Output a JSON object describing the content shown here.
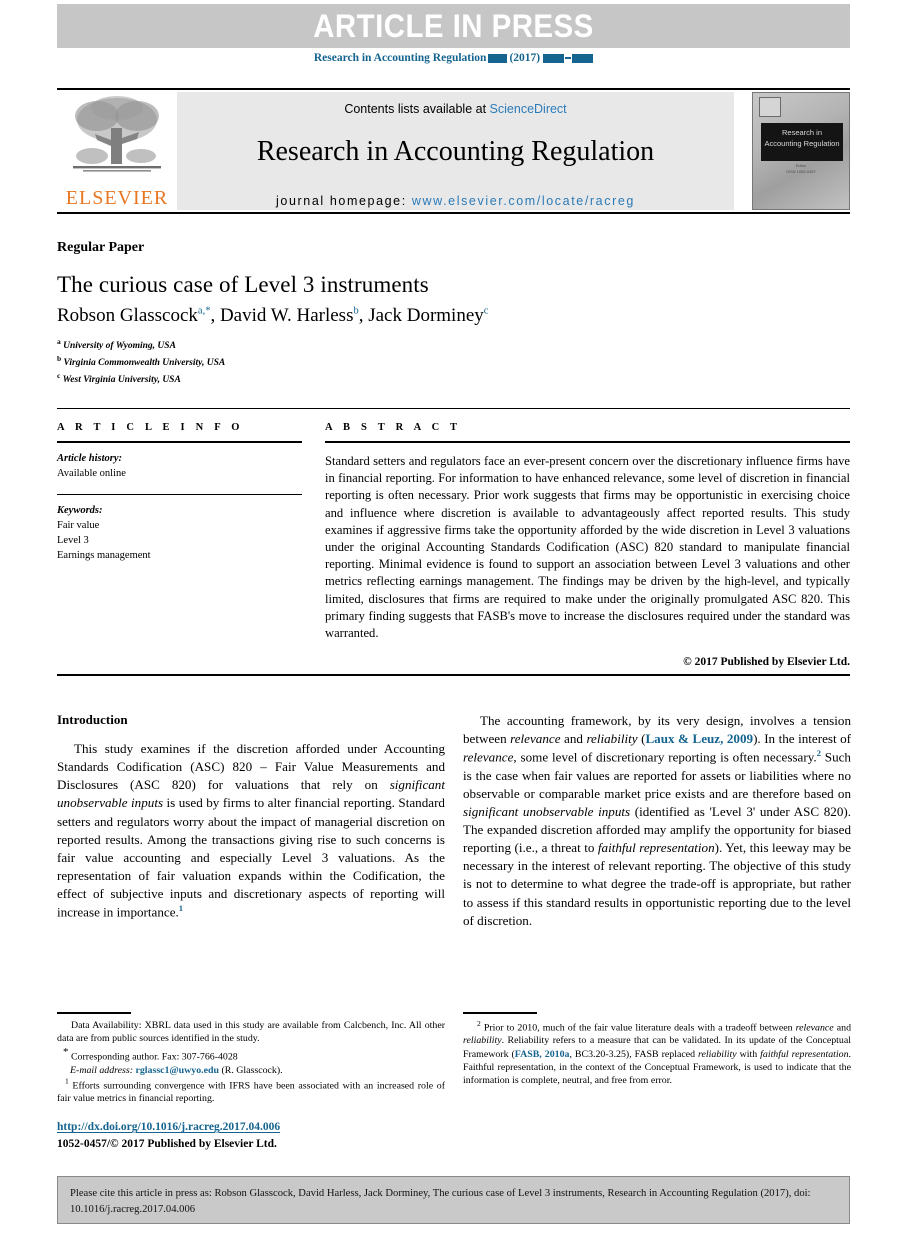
{
  "banner": {
    "article_in_press": "ARTICLE IN PRESS",
    "journal_ref_prefix": "Research in Accounting Regulation",
    "journal_ref_year": "(2017)"
  },
  "masthead": {
    "contents_prefix": "Contents lists available at",
    "contents_link": "ScienceDirect",
    "journal_title": "Research in Accounting Regulation",
    "homepage_label": "journal homepage:",
    "homepage_url": "www.elsevier.com/locate/racreg",
    "publisher_wordmark": "ELSEVIER",
    "cover_title_line1": "Research in",
    "cover_title_line2": "Accounting Regulation",
    "cover_sub_line1": "Editor",
    "cover_sub_line2": "ISSN 1052-0457"
  },
  "article": {
    "type_label": "Regular Paper",
    "title": "The curious case of Level 3 instruments",
    "authors": [
      {
        "name": "Robson Glasscock",
        "marks": "a,*"
      },
      {
        "name": "David W. Harless",
        "marks": "b"
      },
      {
        "name": "Jack Dorminey",
        "marks": "c"
      }
    ],
    "affiliations": [
      {
        "mark": "a",
        "text": "University of Wyoming, USA"
      },
      {
        "mark": "b",
        "text": "Virginia Commonwealth University, USA"
      },
      {
        "mark": "c",
        "text": "West Virginia University, USA"
      }
    ]
  },
  "info": {
    "heading": "A R T I C L E   I N F O",
    "history_label": "Article history:",
    "history_value": "Available online",
    "keywords_label": "Keywords:",
    "keywords": [
      "Fair value",
      "Level 3",
      "Earnings management"
    ]
  },
  "abstract": {
    "heading": "A B S T R A C T",
    "text": "Standard setters and regulators face an ever-present concern over the discretionary influence firms have in financial reporting. For information to have enhanced relevance, some level of discretion in financial reporting is often necessary. Prior work suggests that firms may be opportunistic in exercising choice and influence where discretion is available to advantageously affect reported results. This study examines if aggressive firms take the opportunity afforded by the wide discretion in Level 3 valuations under the original Accounting Standards Codification (ASC) 820 standard to manipulate financial reporting. Minimal evidence is found to support an association between Level 3 valuations and other metrics reflecting earnings management. The findings may be driven by the high-level, and typically limited, disclosures that firms are required to make under the originally promulgated ASC 820. This primary finding suggests that FASB's move to increase the disclosures required under the standard was warranted.",
    "copyright": "© 2017 Published by Elsevier Ltd."
  },
  "body": {
    "intro_heading": "Introduction",
    "left_para_parts": {
      "p1": "This study examines if the discretion afforded under Accounting Standards Codification (ASC) 820 – Fair Value Measurements and Disclosures (ASC 820) for valuations that rely on ",
      "p1_italic": "significant unobservable inputs",
      "p2": " is used by firms to alter financial reporting. Standard setters and regulators worry about the impact of managerial discretion on reported results. Among the transactions giving rise to such concerns is fair value accounting and especially Level 3 valuations. As the representation of fair valuation expands within the Codification, the effect of subjective inputs and discretionary aspects of reporting will increase in importance.",
      "p2_sup": "1"
    },
    "right_para_parts": {
      "r1": "The accounting framework, by its very design, involves a tension between ",
      "r1_i1": "relevance",
      "r2": " and ",
      "r1_i2": "reliability",
      "r3": " (",
      "r_link": "Laux & Leuz, 2009",
      "r4": "). In the interest of ",
      "r1_i3": "relevance",
      "r5": ", some level of discretionary reporting is often necessary.",
      "r_sup": "2",
      "r6": " Such is the case when fair values are reported for assets or liabilities where no observable or comparable market price exists and are therefore based on ",
      "r1_i4": "significant unobservable inputs",
      "r7": " (identified as 'Level 3' under ASC 820). The expanded discretion afforded may amplify the opportunity for biased reporting (i.e., a threat to ",
      "r1_i5": "faithful representation",
      "r8": "). Yet, this leeway may be necessary in the interest of relevant reporting. The objective of this study is not to determine to what degree the trade-off is appropriate, but rather to assess if this standard results in opportunistic reporting due to the level of discretion."
    }
  },
  "footnotes": {
    "data_availability": "Data Availability: XBRL data used in this study are available from Calcbench, Inc. All other data are from public sources identified in the study.",
    "corresponding_star": "*",
    "corresponding": "Corresponding author. Fax: 307-766-4028",
    "email_label": "E-mail address:",
    "email": "rglassc1@uwyo.edu",
    "email_suffix": "(R. Glasscock).",
    "fn1_mark": "1",
    "fn1": "Efforts surrounding convergence with IFRS have been associated with an increased role of fair value metrics in financial reporting.",
    "fn2_mark": "2",
    "fn2_a": "Prior to 2010, much of the fair value literature deals with a tradeoff between ",
    "fn2_i1": "relevance",
    "fn2_b": " and ",
    "fn2_i2": "reliability",
    "fn2_c": ". Reliability refers to a measure that can be validated. In its update of the Conceptual Framework (",
    "fn2_link": "FASB, 2010a",
    "fn2_d": ", BC3.20-3.25), FASB replaced ",
    "fn2_i3": "reliability",
    "fn2_e": " with ",
    "fn2_i4": "faithful representation",
    "fn2_f": ". Faithful representation, in the context of the Conceptual Framework, is used to indicate that the information is complete, neutral, and free from error."
  },
  "publication": {
    "doi_url": "http://dx.doi.org/10.1016/j.racreg.2017.04.006",
    "issn_copyright": "1052-0457/© 2017 Published by Elsevier Ltd."
  },
  "cite_box": {
    "text": "Please cite this article in press as: Robson Glasscock, David Harless, Jack Dorminey, The curious case of Level 3 instruments, Research in Accounting Regulation (2017), doi: 10.1016/j.racreg.2017.04.006"
  },
  "colors": {
    "link_blue": "#15648f",
    "sciencedirect_blue": "#2b7bb9",
    "elsevier_orange": "#e87722",
    "banner_gray": "#c6c6c6",
    "masthead_gray": "#e8e8e8",
    "cite_box_gray": "#c9c9c9"
  }
}
